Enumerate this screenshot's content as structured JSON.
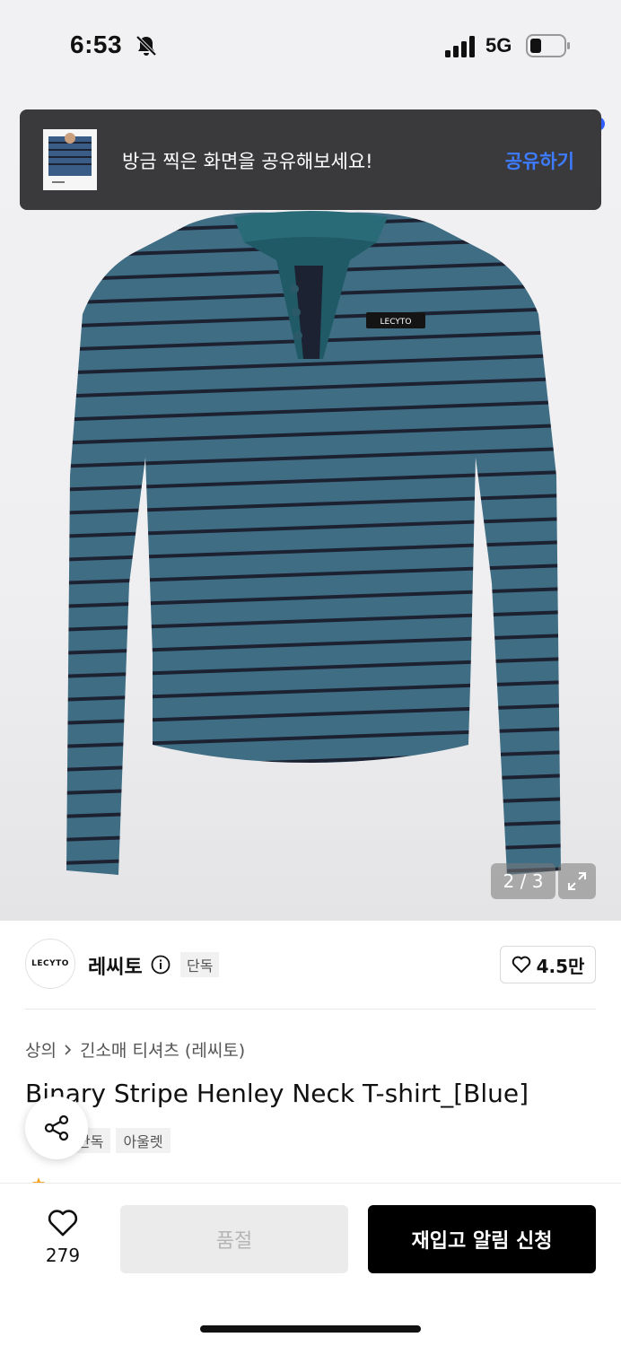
{
  "status_bar": {
    "time": "6:53",
    "network": "5G",
    "icons": [
      "bell-off-icon",
      "signal-icon",
      "battery-icon"
    ]
  },
  "toast": {
    "message": "방금 찍은 화면을 공유해보세요!",
    "action_label": "공유하기",
    "action_color": "#3d7bff"
  },
  "gallery": {
    "counter": "2 / 3",
    "product_label": "LECYTO"
  },
  "brand": {
    "logo_text": "LECYTO",
    "name": "레씨토",
    "badge": "단독",
    "likes": "4.5만"
  },
  "breadcrumb": {
    "parent": "상의",
    "current": "긴소매 티셔츠 (레씨토)"
  },
  "product": {
    "title": "Binary Stripe Henley Neck T-shirt_[Blue]",
    "tags": [
      "단독",
      "아울렛"
    ]
  },
  "bottom_bar": {
    "wish_count": "279",
    "soldout_label": "품절",
    "restock_label": "재입고 알림 신청"
  },
  "colors": {
    "shirt_body": "#3f6e84",
    "shirt_stripe": "#1d2233",
    "accent": "#3d7bff",
    "primary_button": "#000000"
  }
}
